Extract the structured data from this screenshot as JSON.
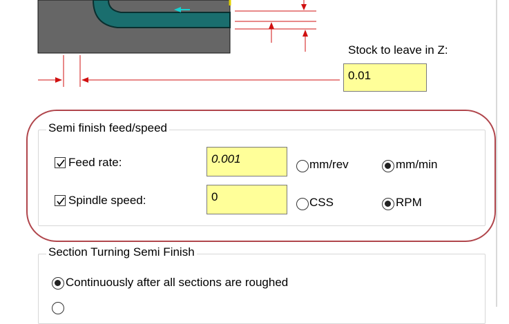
{
  "diagram": {
    "stock_to_leave_z_label": "Stock to leave in Z:",
    "stock_to_leave_z_value": "0.01"
  },
  "semi_finish": {
    "title": "Semi finish feed/speed",
    "feed_rate": {
      "label": "Feed rate:",
      "checked": true,
      "value": "0.001",
      "options": [
        "mm/rev",
        "mm/min"
      ],
      "selected": "mm/min"
    },
    "spindle_speed": {
      "label": "Spindle speed:",
      "checked": true,
      "value": "0",
      "options": [
        "CSS",
        "RPM"
      ],
      "selected": "RPM"
    }
  },
  "section_turning": {
    "title": "Section Turning Semi Finish",
    "options": [
      "Continuously after all sections are roughed"
    ],
    "selected": "Continuously after all sections are roughed"
  },
  "colors": {
    "field_bg": "#ffff99",
    "highlight_ring": "#b0454b",
    "dim_red": "#e02020",
    "part_gray": "#666666",
    "toolpath_teal": "#1a6e6e"
  }
}
